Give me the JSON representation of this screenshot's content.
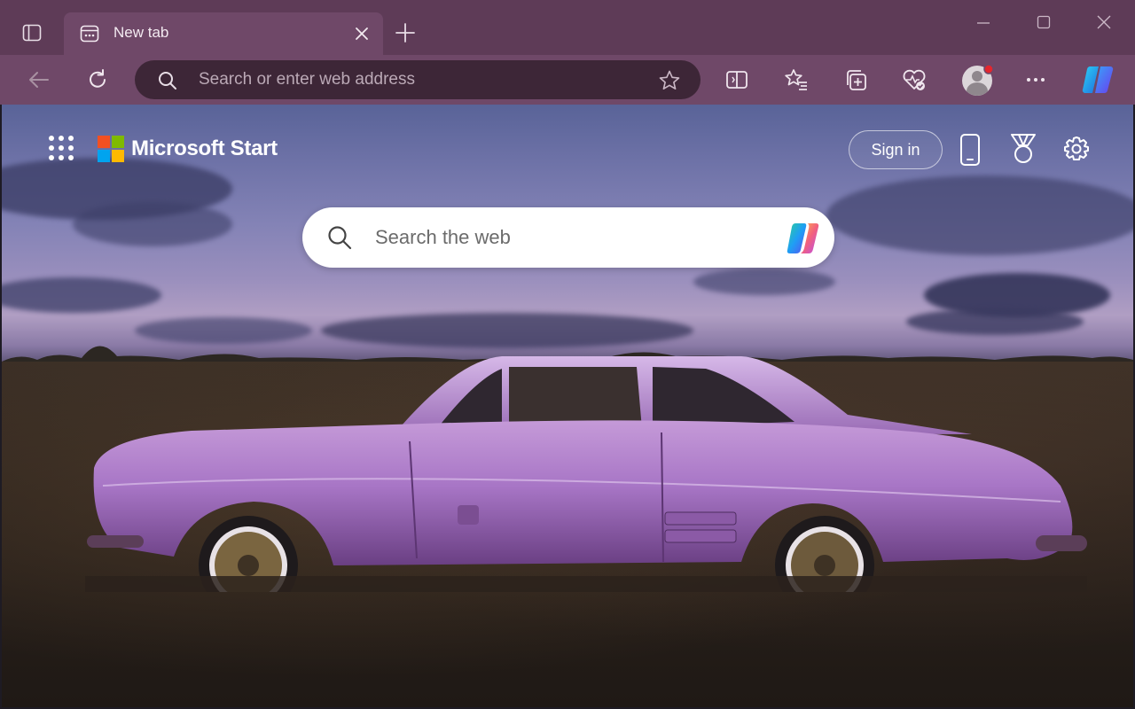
{
  "browser": {
    "tab": {
      "title": "New tab"
    },
    "address_bar": {
      "placeholder": "Search or enter web address"
    }
  },
  "start_page": {
    "brand": "Microsoft Start",
    "sign_in_label": "Sign in",
    "search": {
      "placeholder": "Search the web"
    }
  },
  "colors": {
    "frame": "#5e3b57",
    "toolbar": "#6f4868",
    "address_bar": "#3d2637",
    "ms_red": "#f25022",
    "ms_green": "#7fba00",
    "ms_blue": "#00a4ef",
    "ms_yellow": "#ffb900",
    "car": "#a876c6"
  },
  "icons": [
    "sidebar-toggle-icon",
    "tab-page-icon",
    "close-icon",
    "plus-icon",
    "minimize-icon",
    "maximize-icon",
    "back-arrow-icon",
    "refresh-icon",
    "search-icon",
    "star-icon",
    "split-screen-icon",
    "favorites-icon",
    "collections-icon",
    "browser-essentials-icon",
    "profile-avatar-icon",
    "more-dots-icon",
    "copilot-icon",
    "apps-grid-icon",
    "microsoft-logo-icon",
    "phone-icon",
    "rewards-trophy-icon",
    "gear-icon"
  ]
}
